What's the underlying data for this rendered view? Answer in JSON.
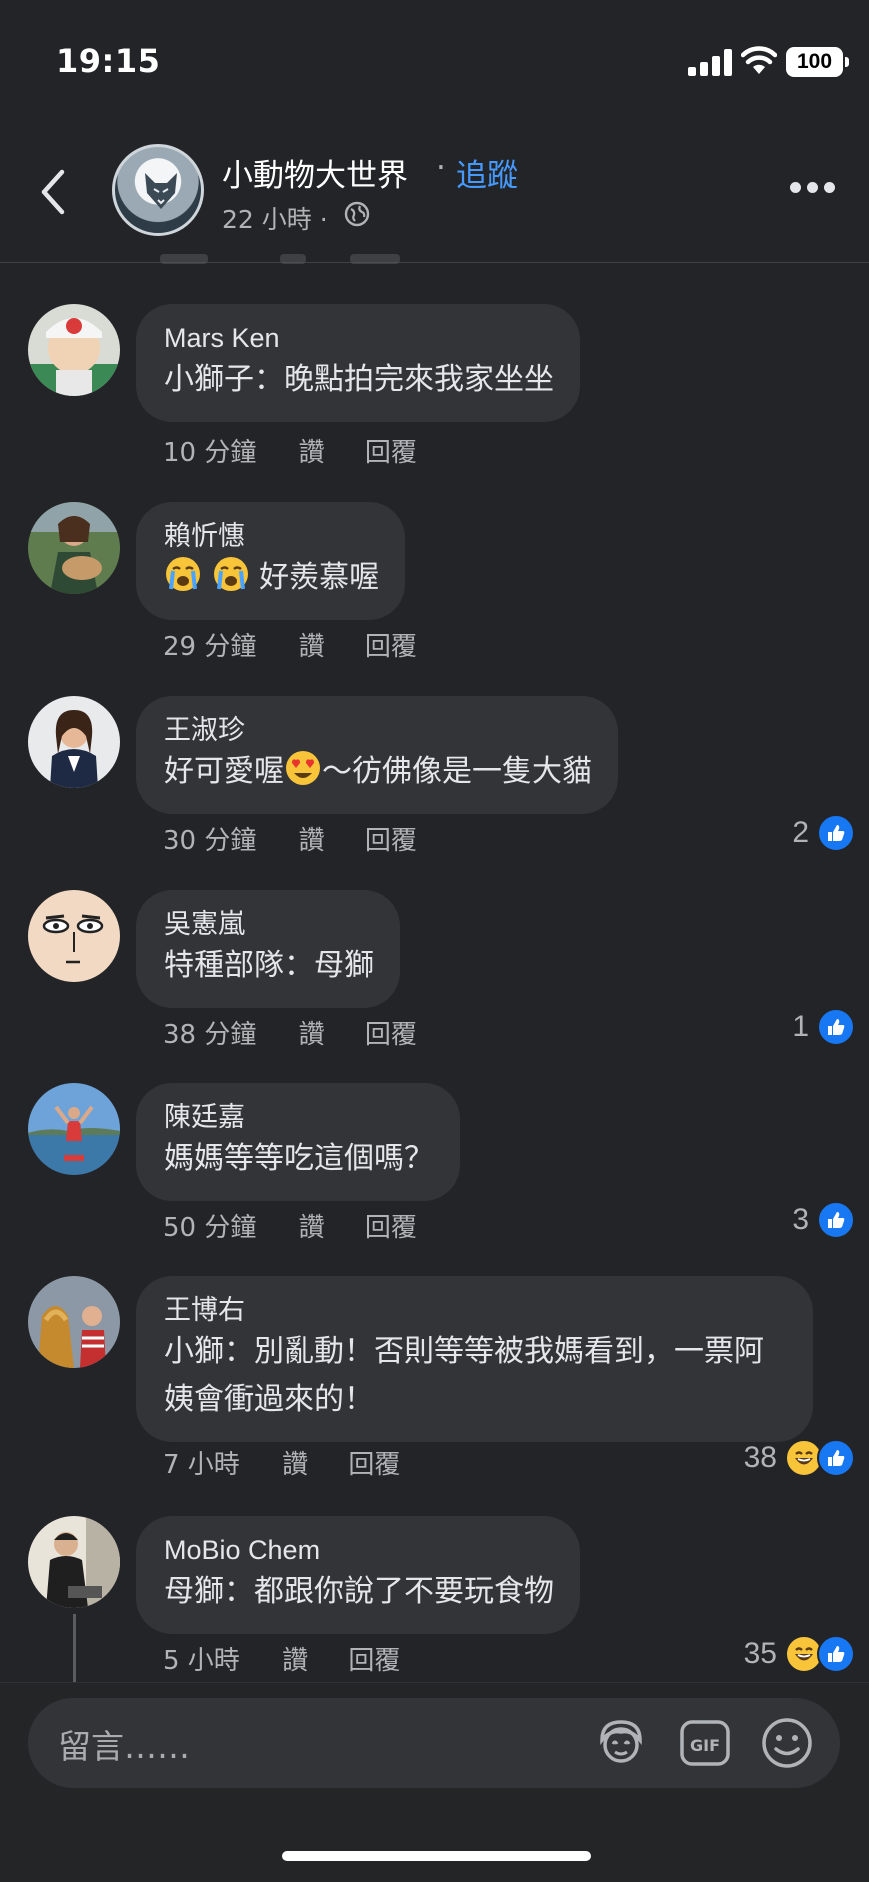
{
  "status_bar": {
    "time": "19:15",
    "battery": "100"
  },
  "header": {
    "page_name": "小動物大世界",
    "separator": "·",
    "follow_label": "追蹤",
    "posted_time": "22 小時 ·"
  },
  "comments": [
    {
      "name": "Mars Ken",
      "text": "小獅子：晚點拍完來我家坐坐",
      "time": "10 分鐘",
      "like_label": "讚",
      "reply_label": "回覆"
    },
    {
      "name": "賴忻憓",
      "text": "好羨慕喔",
      "time": "29 分鐘",
      "like_label": "讚",
      "reply_label": "回覆"
    },
    {
      "name": "王淑珍",
      "text_before": "好可愛喔",
      "text_after": "～彷佛像是一隻大貓",
      "time": "30 分鐘",
      "like_label": "讚",
      "reply_label": "回覆",
      "reaction_count": "2"
    },
    {
      "name": "吳憲嵐",
      "text": "特種部隊：母獅",
      "time": "38 分鐘",
      "like_label": "讚",
      "reply_label": "回覆",
      "reaction_count": "1"
    },
    {
      "name": "陳廷嘉",
      "text": "媽媽等等吃這個嗎？",
      "time": "50 分鐘",
      "like_label": "讚",
      "reply_label": "回覆",
      "reaction_count": "3"
    },
    {
      "name": "王博右",
      "text": "小獅：別亂動！否則等等被我媽看到，一票阿姨會衝過來的！",
      "time": "7 小時",
      "like_label": "讚",
      "reply_label": "回覆",
      "reaction_count": "38"
    },
    {
      "name": "MoBio Chem",
      "text": "母獅：都跟你說了不要玩食物",
      "time": "5 小時",
      "like_label": "讚",
      "reply_label": "回覆",
      "reaction_count": "35"
    }
  ],
  "composer": {
    "placeholder": "留言……"
  },
  "icons": [
    "back-arrow-icon",
    "globe-icon",
    "more-icon",
    "like-reaction-icon",
    "haha-reaction-icon",
    "avatar-sticker-icon",
    "gif-icon",
    "emoji-icon"
  ],
  "colors": {
    "background": "#232427",
    "bubble": "#333437",
    "accent": "#4599ff",
    "like_blue": "#1877f2"
  }
}
